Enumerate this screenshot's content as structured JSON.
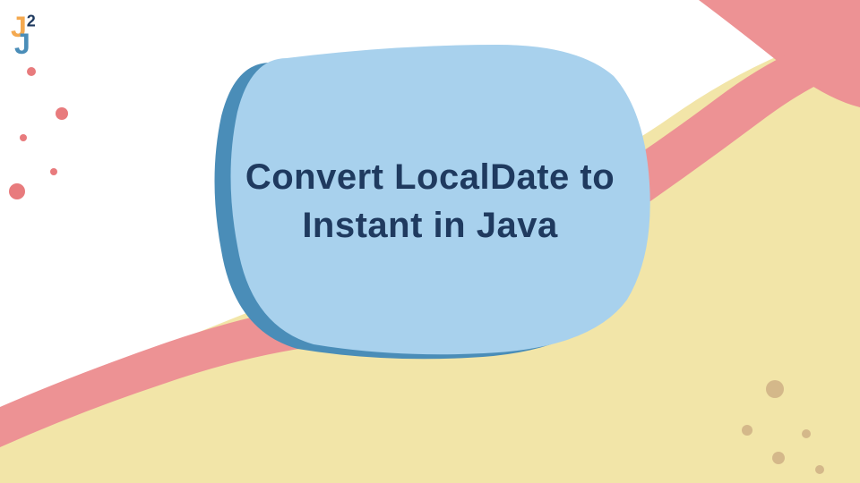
{
  "logo": {
    "letter1": "J",
    "superscript": "2",
    "letter2": "J"
  },
  "title": {
    "line1": "Convert LocalDate to",
    "line2": "Instant in Java"
  },
  "colors": {
    "yellow": "#f2e5a8",
    "pink": "#ed9294",
    "lightblue": "#a8d1ed",
    "darkblue": "#4a8db8",
    "textnavy": "#1f3a5f",
    "orange": "#f4a950",
    "dotpink": "#e87b7d",
    "dottan": "#d4b88a"
  }
}
